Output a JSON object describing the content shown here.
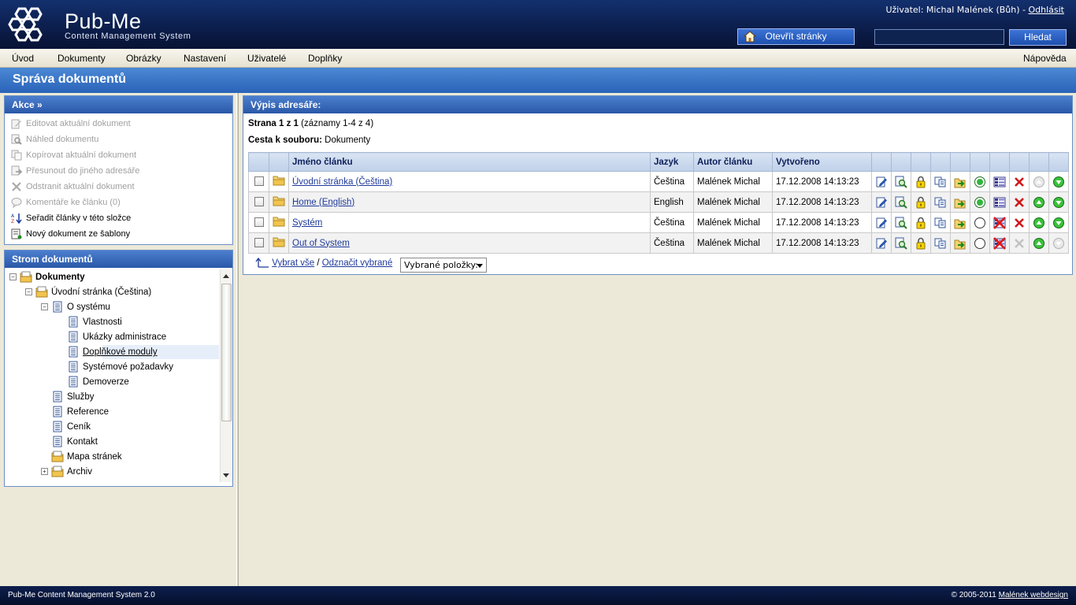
{
  "header": {
    "brand": "Pub-Me",
    "brand_sub": "Content Management System",
    "user_prefix": "Uživatel: Michal Malének (Bůh) -",
    "logout": "Odhlásit",
    "open_site": "Otevřít stránky",
    "search_value": "",
    "search_button": "Hledat"
  },
  "menu": {
    "items": [
      "Úvod",
      "Dokumenty",
      "Obrázky",
      "Nastavení",
      "Uživatelé",
      "Doplňky"
    ],
    "help": "Nápověda"
  },
  "page_title": "Správa dokumentů",
  "actions": {
    "title": "Akce »",
    "items": [
      {
        "label": "Editovat aktuální dokument",
        "icon": "edit-icon",
        "enabled": false
      },
      {
        "label": "Náhled dokumentu",
        "icon": "preview-icon",
        "enabled": false
      },
      {
        "label": "Kopírovat aktuální dokument",
        "icon": "copy-icon",
        "enabled": false
      },
      {
        "label": "Přesunout do jiného adresáře",
        "icon": "move-icon",
        "enabled": false
      },
      {
        "label": "Odstranit aktuální dokument",
        "icon": "delete-icon",
        "enabled": false
      },
      {
        "label": "Komentáře ke článku (0)",
        "icon": "comment-icon",
        "enabled": false
      },
      {
        "label": "Seřadit články v této složce",
        "icon": "sort-icon",
        "enabled": true
      },
      {
        "label": "Nový dokument ze šablony",
        "icon": "new-document-icon",
        "enabled": true
      }
    ]
  },
  "tree": {
    "title": "Strom dokumentů",
    "nodes": [
      {
        "label": "Dokumenty",
        "level": 0,
        "type": "folder",
        "toggle": "−",
        "bold": true
      },
      {
        "label": "Úvodní stránka (Čeština)",
        "level": 1,
        "type": "folder",
        "toggle": "−"
      },
      {
        "label": "O systému",
        "level": 2,
        "type": "page",
        "toggle": "−"
      },
      {
        "label": "Vlastnosti",
        "level": 3,
        "type": "page"
      },
      {
        "label": "Ukázky administrace",
        "level": 3,
        "type": "page"
      },
      {
        "label": "Doplňkové moduly",
        "level": 3,
        "type": "page",
        "selected": true
      },
      {
        "label": "Systémové požadavky",
        "level": 3,
        "type": "page"
      },
      {
        "label": "Demoverze",
        "level": 3,
        "type": "page"
      },
      {
        "label": "Služby",
        "level": 2,
        "type": "page"
      },
      {
        "label": "Reference",
        "level": 2,
        "type": "page"
      },
      {
        "label": "Ceník",
        "level": 2,
        "type": "page"
      },
      {
        "label": "Kontakt",
        "level": 2,
        "type": "page"
      },
      {
        "label": "Mapa stránek",
        "level": 2,
        "type": "folder"
      },
      {
        "label": "Archiv",
        "level": 2,
        "type": "folder",
        "toggle": "+"
      }
    ]
  },
  "listing": {
    "title": "Výpis adresáře:",
    "page_bold": "Strana 1 z 1",
    "page_rest": "(záznamy 1-4 z 4)",
    "path_bold": "Cesta k souboru:",
    "path_value": "Dokumenty",
    "columns": [
      "Jméno článku",
      "Jazyk",
      "Autor článku",
      "Vytvořeno"
    ],
    "rows": [
      {
        "name": "Úvodní stránka (Čeština)",
        "lang": "Čeština",
        "author": "Malének Michal",
        "created": "17.12.2008 14:13:23",
        "published": true,
        "menu": true,
        "delete": true,
        "up": false,
        "down": true
      },
      {
        "name": "Home (English)",
        "lang": "English",
        "author": "Malének Michal",
        "created": "17.12.2008 14:13:23",
        "published": true,
        "menu": true,
        "delete": true,
        "up": true,
        "down": true
      },
      {
        "name": "Systém",
        "lang": "Čeština",
        "author": "Malének Michal",
        "created": "17.12.2008 14:13:23",
        "published": false,
        "menu": false,
        "delete": true,
        "up": true,
        "down": true
      },
      {
        "name": "Out of System",
        "lang": "Čeština",
        "author": "Malének Michal",
        "created": "17.12.2008 14:13:23",
        "published": false,
        "menu": false,
        "delete": false,
        "up": true,
        "down": false
      }
    ],
    "select_all": "Vybrat vše",
    "separator": "/",
    "deselect": "Odznačit vybrané",
    "bulk_select": "Vybrané položky:"
  },
  "footer": {
    "left": "Pub-Me Content Management System 2.0",
    "right_prefix": "© 2005-2011",
    "right_link": "Malének webdesign"
  },
  "colors": {
    "header_bg": "#0a1a44",
    "title_bar": "#2a63b8",
    "panel_border": "#6b8fc8",
    "link": "#1f3a9a"
  }
}
